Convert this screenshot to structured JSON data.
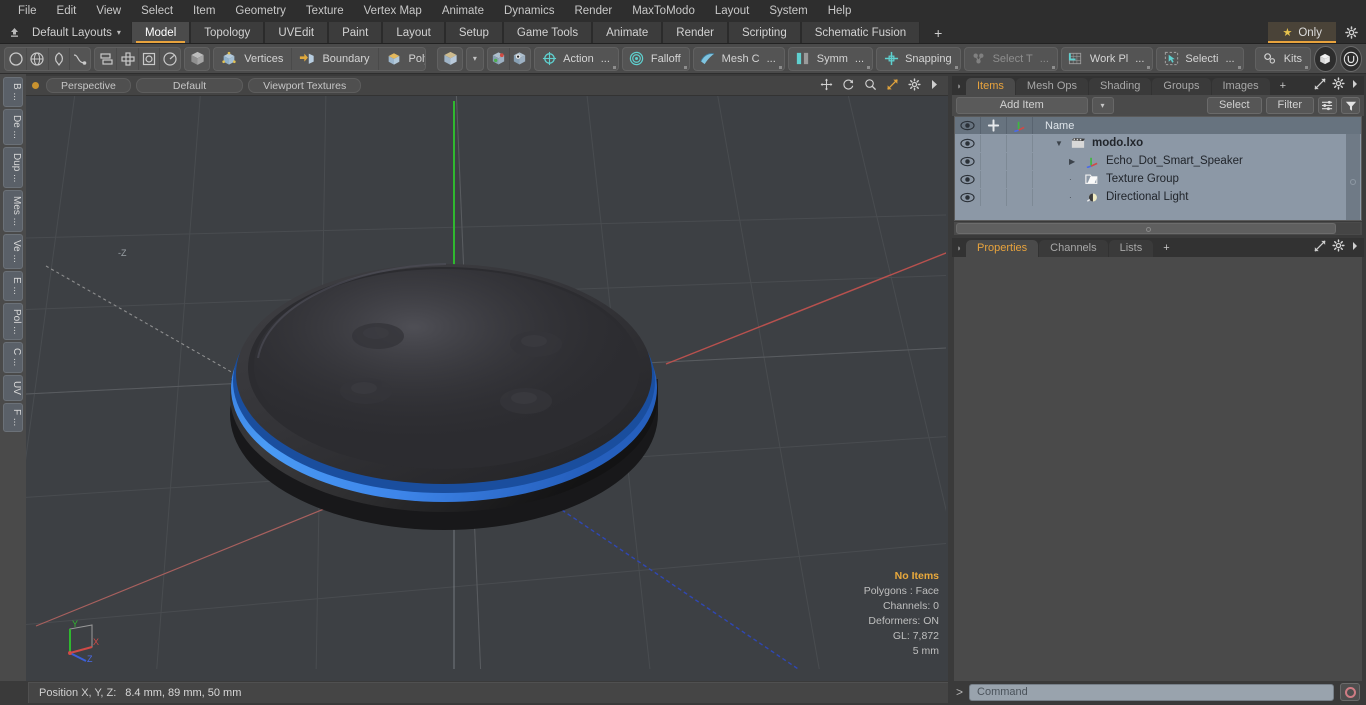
{
  "menu": {
    "items": [
      "File",
      "Edit",
      "View",
      "Select",
      "Item",
      "Geometry",
      "Texture",
      "Vertex Map",
      "Animate",
      "Dynamics",
      "Render",
      "MaxToModo",
      "Layout",
      "System",
      "Help"
    ]
  },
  "layout_bar": {
    "home_icon": "home-arrow-icon",
    "layouts_label": "Default Layouts",
    "caret": "▾",
    "tabs": [
      "Model",
      "Topology",
      "UVEdit",
      "Paint",
      "Layout",
      "Setup",
      "Game Tools",
      "Animate",
      "Render",
      "Scripting",
      "Schematic Fusion"
    ],
    "active_tab": "Model",
    "plus_label": "+",
    "only_label": "Only",
    "only_star": "★",
    "gear_icon": "gear-icon"
  },
  "toolbar": {
    "shape_icons": [
      "circle-icon",
      "globe-icon",
      "pen-icon",
      "curve-icon"
    ],
    "arrange_icons": [
      "align-icon",
      "center-icon",
      "frame-icon",
      "radial-icon"
    ],
    "cube_icon": "cube-icon",
    "selection_modes": [
      {
        "label": "Vertices",
        "icon": "vertices-icon"
      },
      {
        "label": "Boundary",
        "icon": "boundary-icon"
      },
      {
        "label": "Polygons",
        "icon": "polygons-icon"
      }
    ],
    "item_cube_icon": "item-cube-icon",
    "dropdown_caret": "▾",
    "snap_icons": [
      "snap-a-icon",
      "snap-b-icon"
    ],
    "tools": [
      {
        "label": "Action",
        "suffix": "...",
        "icon": "action-center-icon",
        "dim": false
      },
      {
        "label": "Falloff",
        "suffix": "",
        "icon": "falloff-icon",
        "dim": false
      },
      {
        "label": "Mesh C",
        "suffix": "...",
        "icon": "mesh-constraint-icon",
        "dim": false
      },
      {
        "label": "Symm",
        "suffix": "...",
        "icon": "symmetry-icon",
        "dim": false
      },
      {
        "label": "Snapping",
        "suffix": "",
        "icon": "snapping-icon",
        "dim": false
      },
      {
        "label": "Select T",
        "suffix": "...",
        "icon": "select-through-icon",
        "dim": true
      },
      {
        "label": "Work Pl",
        "suffix": "...",
        "icon": "work-plane-icon",
        "dim": false
      },
      {
        "label": "Selecti",
        "suffix": "...",
        "icon": "selection-set-icon",
        "dim": false
      }
    ],
    "kits_label": "Kits",
    "kits_icon": "kits-gears-icon",
    "app_icons": [
      "modo-badge-icon",
      "unreal-badge-icon"
    ]
  },
  "left_tabs": {
    "items": [
      "B ...",
      "De ...",
      "Dup ...",
      "Mes ...",
      "Ve ...",
      "E ...",
      "Pol ...",
      "C ...",
      "UV",
      "F ..."
    ]
  },
  "viewport": {
    "header": {
      "dot": "viewport-active-dot",
      "buttons": [
        "Perspective",
        "Default",
        "Viewport Textures"
      ],
      "icons": [
        "pan-icon",
        "rotate-icon",
        "zoom-icon",
        "fit-icon",
        "gear-icon",
        "chevron-right-icon"
      ]
    },
    "stats": {
      "selection": "No Items",
      "polygons": "Polygons : Face",
      "channels": "Channels: 0",
      "deformers": "Deformers: ON",
      "gl": "GL: 7,872",
      "grid": "5 mm"
    },
    "axis_gizmo": {
      "x": "X",
      "y": "Y",
      "z": "Z"
    },
    "colors": {
      "background": "#3d4044",
      "grid": "#4a4d51",
      "axis_x": "#c0504d",
      "axis_y": "#3fb83f",
      "axis_z": "#3a56c8",
      "model_body": "#2c2c2e",
      "light_ring": "#2f86e8"
    }
  },
  "right_panel": {
    "top_tabs": [
      "Items",
      "Mesh Ops",
      "Shading",
      "Groups",
      "Images"
    ],
    "top_tabs_active": "Items",
    "top_tabs_plus": "+",
    "panel_icons": [
      "expand-icon",
      "gear-icon",
      "chevron-right-icon"
    ],
    "controls": {
      "add_item_label": "Add Item",
      "add_item_caret": "▾",
      "select_label": "Select",
      "filter_label": "Filter",
      "list_options_icon": "list-options-icon",
      "funnel_icon": "funnel-icon"
    },
    "tree": {
      "columns": [
        "eye-icon",
        "lock-icon",
        "axis-icon",
        "Name"
      ],
      "rows": [
        {
          "name": "modo.lxo",
          "icon": "scene-icon",
          "depth": 0,
          "expander": "▼",
          "bold": true,
          "eye": "eye-icon"
        },
        {
          "name": "Echo_Dot_Smart_Speaker",
          "icon": "mesh-axis-icon",
          "depth": 1,
          "expander": "▶",
          "bold": false,
          "eye": "eye-icon"
        },
        {
          "name": "Texture Group",
          "icon": "texture-group-icon",
          "depth": 1,
          "expander": "",
          "bold": false,
          "eye": "eye-icon"
        },
        {
          "name": "Directional Light",
          "icon": "light-icon",
          "depth": 1,
          "expander": "",
          "bold": false,
          "eye": "eye-icon"
        }
      ]
    },
    "bottom_tabs": [
      "Properties",
      "Channels",
      "Lists"
    ],
    "bottom_tabs_active": "Properties",
    "bottom_tabs_plus": "+"
  },
  "status_bar": {
    "position_label": "Position X, Y, Z:",
    "position_value": "8.4 mm, 89 mm, 50 mm",
    "prompt": ">",
    "command_placeholder": "Command",
    "record_icon": "record-icon"
  }
}
